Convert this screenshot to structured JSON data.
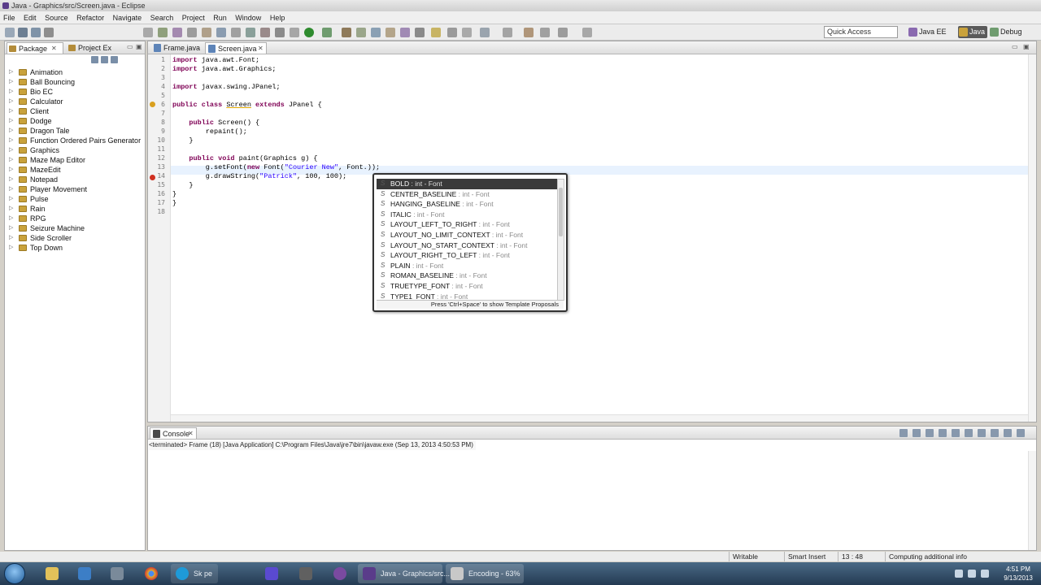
{
  "window": {
    "title": "Java - Graphics/src/Screen.java - Eclipse"
  },
  "menu": [
    "File",
    "Edit",
    "Source",
    "Refactor",
    "Navigate",
    "Search",
    "Project",
    "Run",
    "Window",
    "Help"
  ],
  "toolbar": {
    "quick_access": "Quick Access",
    "perspectives": [
      "Java EE",
      "Java",
      "Debug"
    ]
  },
  "left_panel": {
    "tabs": [
      "Package",
      "Project Ex"
    ],
    "projects": [
      "Animation",
      "Ball Bouncing",
      "Bio EC",
      "Calculator",
      "Client",
      "Dodge",
      "Dragon Tale",
      "Function Ordered Pairs Generator",
      "Graphics",
      "Maze Map Editor",
      "MazeEdit",
      "Notepad",
      "Player Movement",
      "Pulse",
      "Rain",
      "RPG",
      "Seizure Machine",
      "Side Scroller",
      "Top Down"
    ]
  },
  "editor": {
    "tabs": [
      "Frame.java",
      "Screen.java"
    ],
    "line_numbers": [
      "1",
      "2",
      "3",
      "4",
      "5",
      "6",
      "7",
      "8",
      "9",
      "10",
      "11",
      "12",
      "13",
      "14",
      "15",
      "16",
      "17",
      "18"
    ]
  },
  "autocomplete": {
    "items": [
      {
        "name": "BOLD",
        "type": " : int - Font"
      },
      {
        "name": "CENTER_BASELINE",
        "type": " : int - Font"
      },
      {
        "name": "HANGING_BASELINE",
        "type": " : int - Font"
      },
      {
        "name": "ITALIC",
        "type": " : int - Font"
      },
      {
        "name": "LAYOUT_LEFT_TO_RIGHT",
        "type": " : int - Font"
      },
      {
        "name": "LAYOUT_NO_LIMIT_CONTEXT",
        "type": " : int - Font"
      },
      {
        "name": "LAYOUT_NO_START_CONTEXT",
        "type": " : int - Font"
      },
      {
        "name": "LAYOUT_RIGHT_TO_LEFT",
        "type": " : int - Font"
      },
      {
        "name": "PLAIN",
        "type": " : int - Font"
      },
      {
        "name": "ROMAN_BASELINE",
        "type": " : int - Font"
      },
      {
        "name": "TRUETYPE_FONT",
        "type": " : int - Font"
      },
      {
        "name": "TYPE1_FONT",
        "type": " : int - Font"
      }
    ],
    "hint": "Press 'Ctrl+Space' to show Template Proposals"
  },
  "console": {
    "tab": "Console",
    "status": "<terminated> Frame (18) [Java Application] C:\\Program Files\\Java\\jre7\\bin\\javaw.exe (Sep 13, 2013 4:50:53 PM)"
  },
  "statusbar": {
    "writable": "Writable",
    "insert_mode": "Smart Insert",
    "position": "13 : 48",
    "progress": "Computing additional info"
  },
  "taskbar": {
    "skype": "Sk pe",
    "eclipse": "Java - Graphics/src...",
    "encoding": "Encoding - 63%",
    "time": "4:51 PM",
    "date": "9/13/2013"
  },
  "colors": {
    "keyword": "#7f0055",
    "string": "#2a00ff",
    "selection": "#3a3a3a"
  }
}
